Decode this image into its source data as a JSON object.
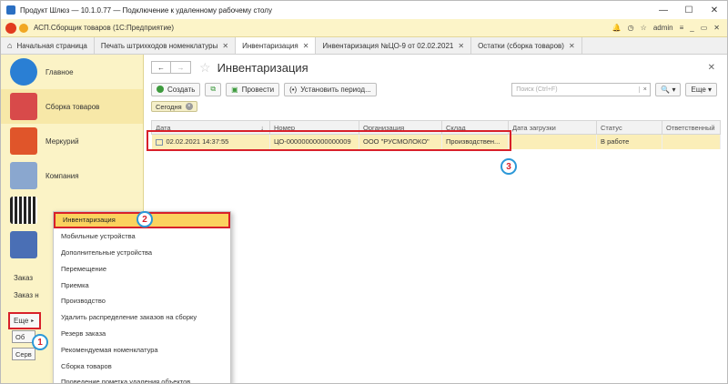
{
  "window": {
    "title": "Продукт Шлюз — 10.1.0.77 — Подключение к удаленному рабочему столу",
    "minimize": "—",
    "maximize": "☐",
    "close": "✕"
  },
  "app": {
    "title": "АСП.Сборщик товаров  (1С:Предприятие)",
    "user": "admin",
    "icons": [
      "bell-icon",
      "history-icon",
      "star-icon",
      "settings-icon"
    ]
  },
  "tabs": [
    {
      "label": "Начальная страница"
    },
    {
      "label": "Печать штрихкодов номенклатуры",
      "close": "✕"
    },
    {
      "label": "Инвентаризация",
      "close": "✕"
    },
    {
      "label": "Инвентаризация №ЦО-9 от 02.02.2021",
      "close": "✕"
    },
    {
      "label": "Остатки (сборка товаров)",
      "close": "✕"
    }
  ],
  "sidebar": {
    "items": [
      {
        "label": "Главное",
        "color": "#2a7fd4"
      },
      {
        "label": "Сборка товаров",
        "color": "#d84a4a"
      },
      {
        "label": "Меркурий",
        "color": "#e0552a"
      },
      {
        "label": "Компания",
        "color": "#8aa7cf"
      },
      {
        "label": "",
        "color": "#222222"
      },
      {
        "label": "",
        "color": "#4a6fb5"
      }
    ],
    "bottom_links": [
      "Заказ",
      "Заказ н"
    ],
    "more_button": "Еще",
    "small_buttons": [
      "Об",
      "Серв"
    ]
  },
  "doc": {
    "title": "Инвентаризация",
    "back": "←",
    "forward": "→",
    "star": "☆",
    "close": "✕",
    "toolbar": {
      "create": "Создать",
      "post": "Провести",
      "set_period": "Установить период...",
      "search_placeholder": "Поиск (Ctrl+F)",
      "search_clear": "×",
      "search_button": "🔍 ▾",
      "more": "Еще ▾"
    },
    "filter": "Сегодня",
    "table": {
      "headers": [
        "Дата",
        "Номер",
        "Организация",
        "Склад",
        "Дата загрузки",
        "Статус",
        "Ответственный"
      ],
      "sort_arrow": "↓",
      "rows": [
        [
          "02.02.2021 14:37:55",
          "ЦО-00000000000000009",
          "ООО \"РУСМОЛОКО\"",
          "Производствен...",
          "",
          "В работе",
          ""
        ]
      ]
    }
  },
  "menu": {
    "items": [
      "Инвентаризация",
      "Мобильные устройства",
      "Дополнительные устройства",
      "Перемещение",
      "Приемка",
      "Производство",
      "Удалить распределение заказов на сборку",
      "Резерв заказа",
      "Рекомендуемая номенклатура",
      "Сборка товаров",
      "Проведение пометка удаления объектов"
    ]
  },
  "markers": [
    "1",
    "2",
    "3"
  ],
  "colors": {
    "accent_red": "#d8202a",
    "marker_blue": "#2b98d8",
    "sidebar": "#fbf3c6",
    "highlight": "#fbd25e"
  }
}
